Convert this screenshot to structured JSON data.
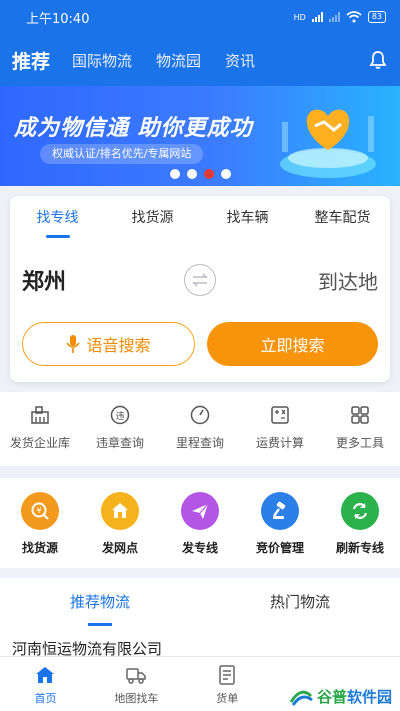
{
  "status": {
    "time": "上午10:40",
    "signal_label": "HD",
    "battery": "83"
  },
  "nav": {
    "title": "推荐",
    "tabs": [
      "国际物流",
      "物流园",
      "资讯"
    ],
    "bell_icon": "bell-icon"
  },
  "banner": {
    "headline": "成为物信通 助你更成功",
    "sub": "权威认证/排名优先/专属网站",
    "slide_count": 4,
    "active_slide": 2
  },
  "search": {
    "tabs": [
      "找专线",
      "找货源",
      "找车辆",
      "整车配货"
    ],
    "active_tab": 0,
    "from": "郑州",
    "to_placeholder": "到达地",
    "voice_button": "语音搜索",
    "search_button": "立即搜索"
  },
  "tools": [
    {
      "label": "发货企业库",
      "icon": "warehouse-icon"
    },
    {
      "label": "违章查询",
      "icon": "violation-icon"
    },
    {
      "label": "里程查询",
      "icon": "mileage-icon"
    },
    {
      "label": "运费计算",
      "icon": "calculator-icon"
    },
    {
      "label": "更多工具",
      "icon": "grid-icon"
    }
  ],
  "features": [
    {
      "label": "找货源",
      "icon": "yuan-search-icon",
      "color": "#f39a1e"
    },
    {
      "label": "发网点",
      "icon": "home-icon",
      "color": "#f5b21d"
    },
    {
      "label": "发专线",
      "icon": "paper-plane-icon",
      "color": "#b356e6"
    },
    {
      "label": "竞价管理",
      "icon": "gavel-icon",
      "color": "#2d7fe8"
    },
    {
      "label": "刷新专线",
      "icon": "refresh-icon",
      "color": "#2bb24c"
    }
  ],
  "recommend": {
    "tabs": [
      "推荐物流",
      "热门物流"
    ],
    "active_tab": 0,
    "first_company": "河南恒运物流有限公司"
  },
  "bottom_nav": [
    {
      "label": "首页",
      "icon": "home-icon"
    },
    {
      "label": "地图找车",
      "icon": "truck-icon"
    },
    {
      "label": "货单",
      "icon": "document-icon"
    }
  ],
  "watermark": {
    "text_a": "谷普",
    "text_b": "软件园"
  },
  "colors": {
    "primary": "#1a73e8",
    "orange": "#f7940c"
  }
}
